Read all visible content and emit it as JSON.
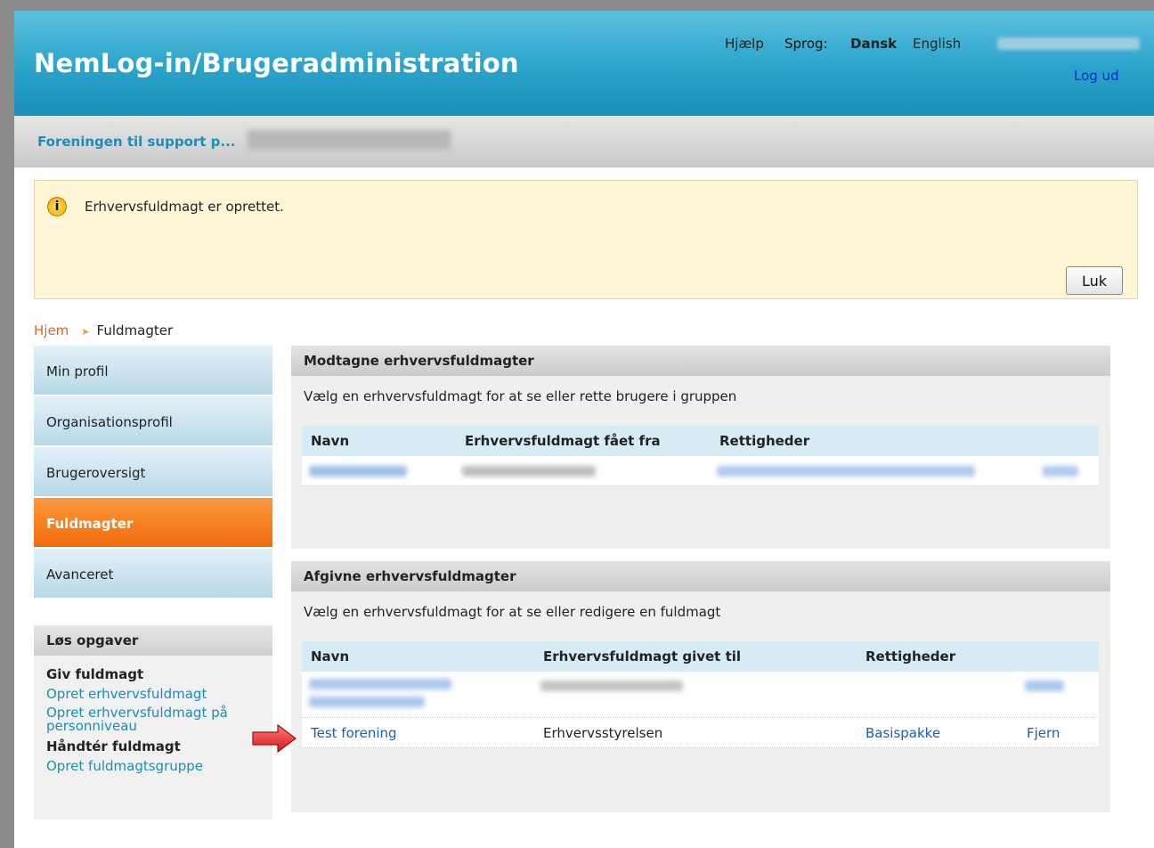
{
  "header": {
    "title": "NemLog-in/Brugeradministration",
    "help": "Hjælp",
    "language_label": "Sprog:",
    "lang_dansk": "Dansk",
    "lang_english": "English",
    "logout": "Log ud"
  },
  "org": {
    "name": "Foreningen til support p..."
  },
  "info": {
    "message": "Erhvervsfuldmagt er oprettet.",
    "icon": "i",
    "close_label": "Luk"
  },
  "breadcrumb": {
    "home": "Hjem",
    "current": "Fuldmagter"
  },
  "sidebar": {
    "items": [
      {
        "label": "Min profil"
      },
      {
        "label": "Organisationsprofil"
      },
      {
        "label": "Brugeroversigt"
      },
      {
        "label": "Fuldmagter",
        "active": true
      },
      {
        "label": "Avanceret"
      }
    ]
  },
  "tasks": {
    "title": "Løs opgaver",
    "group1": "Giv fuldmagt",
    "link1": "Opret erhvervsfuldmagt",
    "link2": "Opret erhvervsfuldmagt på personniveau",
    "group2": "Håndtér fuldmagt",
    "link3": "Opret fuldmagtsgruppe"
  },
  "received": {
    "title": "Modtagne erhvervsfuldmagter",
    "desc": "Vælg en erhvervsfuldmagt for at se eller rette brugere i gruppen",
    "col_name": "Navn",
    "col_from": "Erhvervsfuldmagt fået fra",
    "col_rights": "Rettigheder"
  },
  "given": {
    "title": "Afgivne erhvervsfuldmagter",
    "desc": "Vælg en erhvervsfuldmagt for at se eller redigere en fuldmagt",
    "col_name": "Navn",
    "col_to": "Erhvervsfuldmagt givet til",
    "col_rights": "Rettigheder",
    "row2": {
      "name": "Test forening",
      "to": "Erhvervsstyrelsen",
      "rights": "Basispakke",
      "action": "Fjern"
    }
  },
  "colors": {
    "header_blue": "#2aa3ca",
    "active_orange": "#f57a1c",
    "link_blue": "#1a5fb8"
  }
}
